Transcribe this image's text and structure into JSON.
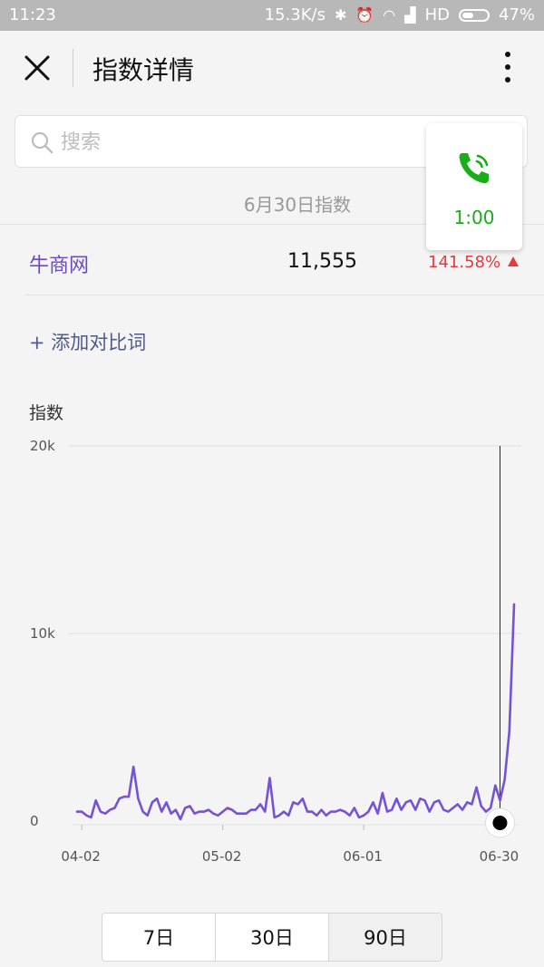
{
  "status_bar": {
    "time": "11:23",
    "network_speed": "15.3K/s",
    "signal_text": "HD",
    "battery": "47%",
    "icons": [
      "bluetooth-icon",
      "alarm-icon",
      "wifi-icon",
      "signal-icon",
      "battery-icon"
    ]
  },
  "header": {
    "title": "指数详情",
    "close_icon": "close-icon",
    "more_icon": "more-vertical-icon"
  },
  "search": {
    "placeholder": "搜索",
    "value": ""
  },
  "call_widget": {
    "timer": "1:00",
    "icon": "phone-icon",
    "color": "#1aad19"
  },
  "summary": {
    "date_label": "6月30日指数",
    "keyword": "牛商网",
    "value": "11,555",
    "change": "141.58%",
    "trend_icon": "triangle-up-icon",
    "keyword_color": "#6a4bc4",
    "change_color": "#e53b3b"
  },
  "actions": {
    "add_compare": "+ 添加对比词"
  },
  "chart_data": {
    "type": "line",
    "ylabel": "指数",
    "ylim": [
      0,
      20000
    ],
    "y_ticks": [
      {
        "value": 0,
        "label": "0"
      },
      {
        "value": 10000,
        "label": "10k"
      },
      {
        "value": 20000,
        "label": "20k"
      }
    ],
    "x_ticks": [
      {
        "index": 1,
        "label": "04-02"
      },
      {
        "index": 31,
        "label": "05-02"
      },
      {
        "index": 61,
        "label": "06-01"
      },
      {
        "index": 90,
        "label": "06-30"
      }
    ],
    "series_color": "#7453d4",
    "values": [
      500,
      500,
      300,
      200,
      1100,
      500,
      400,
      600,
      700,
      1200,
      1300,
      1300,
      2900,
      1200,
      500,
      300,
      1000,
      1200,
      500,
      1000,
      400,
      600,
      100,
      700,
      800,
      400,
      500,
      500,
      600,
      400,
      300,
      500,
      700,
      600,
      400,
      400,
      400,
      600,
      600,
      900,
      500,
      2300,
      200,
      300,
      500,
      300,
      1000,
      900,
      1200,
      500,
      500,
      300,
      600,
      300,
      500,
      500,
      600,
      500,
      300,
      700,
      200,
      300,
      500,
      1000,
      400,
      1500,
      500,
      600,
      1200,
      600,
      1000,
      1100,
      600,
      1200,
      1100,
      500,
      1000,
      1100,
      600,
      500,
      700,
      900,
      600,
      1000,
      900,
      1800,
      800,
      500,
      700,
      1900,
      1100,
      2200,
      4800,
      11555
    ],
    "highlight_index": 90,
    "grid": true
  },
  "range_selector": {
    "options": [
      "7日",
      "30日",
      "90日"
    ],
    "selected": "90日"
  }
}
